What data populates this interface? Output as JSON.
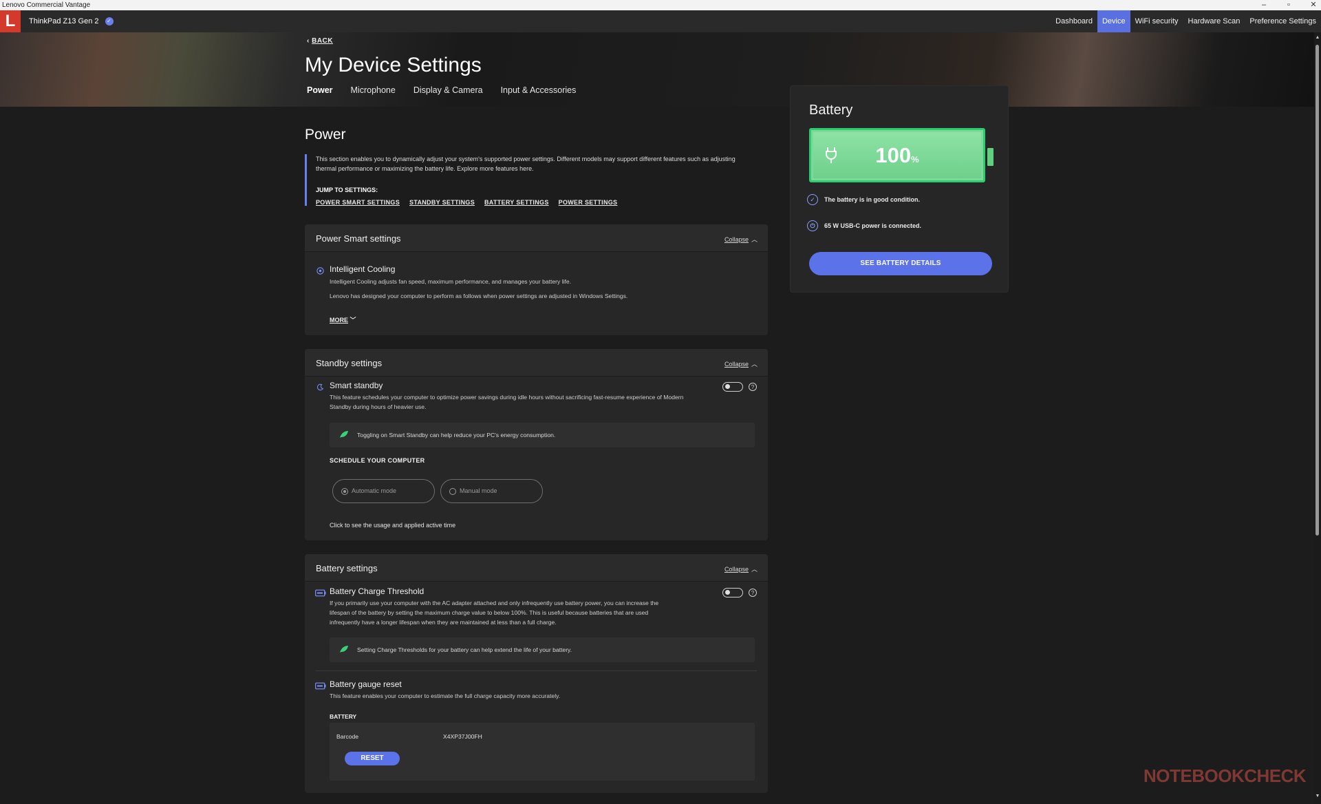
{
  "os": {
    "title": "Lenovo Commercial Vantage",
    "controls": [
      "–",
      "▫",
      "✕"
    ]
  },
  "app": {
    "logo": "L",
    "device_name": "ThinkPad Z13 Gen 2",
    "nav": [
      "Dashboard",
      "Device",
      "WiFi security",
      "Hardware Scan",
      "Preference Settings"
    ],
    "nav_active": "Device"
  },
  "header": {
    "back": "BACK",
    "title": "My Device Settings",
    "tabs": [
      "Power",
      "Microphone",
      "Display & Camera",
      "Input & Accessories"
    ],
    "active_tab": "Power"
  },
  "power": {
    "title": "Power",
    "intro": "This section enables you to dynamically adjust your system's supported power settings. Different models may support different features such as adjusting thermal performance or maximizing the battery life. Explore more features here.",
    "jump_label": "JUMP TO SETTINGS:",
    "jump_links": [
      "POWER SMART SETTINGS",
      "STANDBY SETTINGS",
      "BATTERY SETTINGS",
      "POWER SETTINGS"
    ]
  },
  "power_smart": {
    "title": "Power Smart settings",
    "collapse": "Collapse",
    "feature_title": "Intelligent Cooling",
    "desc1": "Intelligent Cooling adjusts fan speed, maximum performance, and manages your battery life.",
    "desc2": "Lenovo has designed your computer to perform as follows when power settings are adjusted in Windows Settings.",
    "more": "MORE"
  },
  "standby": {
    "title": "Standby settings",
    "collapse": "Collapse",
    "feature_title": "Smart standby",
    "desc": "This feature schedules your computer to optimize power savings during idle hours without sacrificing fast-resume experience of Modern Standby during hours of heavier use.",
    "tip": "Toggling on Smart Standby can help reduce your PC's energy consumption.",
    "schedule_label": "SCHEDULE YOUR COMPUTER",
    "modes": [
      "Automatic mode",
      "Manual mode"
    ],
    "usage_text": "Click to see the usage and applied active time"
  },
  "battery_settings": {
    "title": "Battery settings",
    "collapse": "Collapse",
    "threshold_title": "Battery Charge Threshold",
    "threshold_desc": "If you primarily use your computer with the AC adapter attached and only infrequently use battery power, you can increase the lifespan of the battery by setting the maximum charge value to below 100%. This is useful because batteries that are used infrequently have a longer lifespan when they are maintained at less than a full charge.",
    "tip": "Setting Charge Thresholds for your battery can help extend the life of your battery.",
    "gauge_title": "Battery gauge reset",
    "gauge_desc": "This feature enables your computer to estimate the full charge capacity more accurately.",
    "battery_label": "BATTERY",
    "barcode_label": "Barcode",
    "barcode_value": "X4XP37J00FH",
    "reset": "RESET"
  },
  "battery_panel": {
    "title": "Battery",
    "percent": "100",
    "percent_sign": "%",
    "status1": "The battery is in good condition.",
    "status2": "65 W USB-C power is connected.",
    "button": "SEE BATTERY DETAILS"
  },
  "watermark": "NOTEBOOKCHECK",
  "colors": {
    "accent": "#5b72e8",
    "battery_green": "#6ed08b",
    "logo_red": "#d33a2c"
  }
}
